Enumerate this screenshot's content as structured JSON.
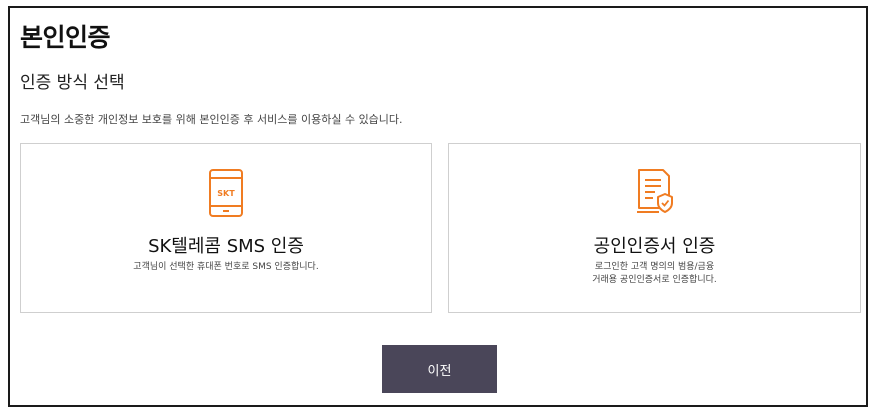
{
  "page": {
    "title": "본인인증",
    "subtitle": "인증 방식 선택",
    "description": "고객님의 소중한 개인정보 보호를 위해 본인인증 후 서비스를 이용하실 수 있습니다."
  },
  "cards": [
    {
      "icon": "phone-icon",
      "icon_text": "SKT",
      "title": "SK텔레콤 SMS 인증",
      "desc_lines": [
        "고객님이 선택한 휴대폰 번호로 SMS 인증합니다."
      ]
    },
    {
      "icon": "certificate-icon",
      "title": "공인인증서 인증",
      "desc_lines": [
        "로그인한 고객 명의의 범용/금융",
        "거래용 공인인증서로 인증합니다."
      ]
    }
  ],
  "buttons": {
    "prev_label": "이전"
  },
  "colors": {
    "accent": "#f07c22",
    "button_bg": "#4a4659",
    "card_border": "#cfcfcf"
  }
}
